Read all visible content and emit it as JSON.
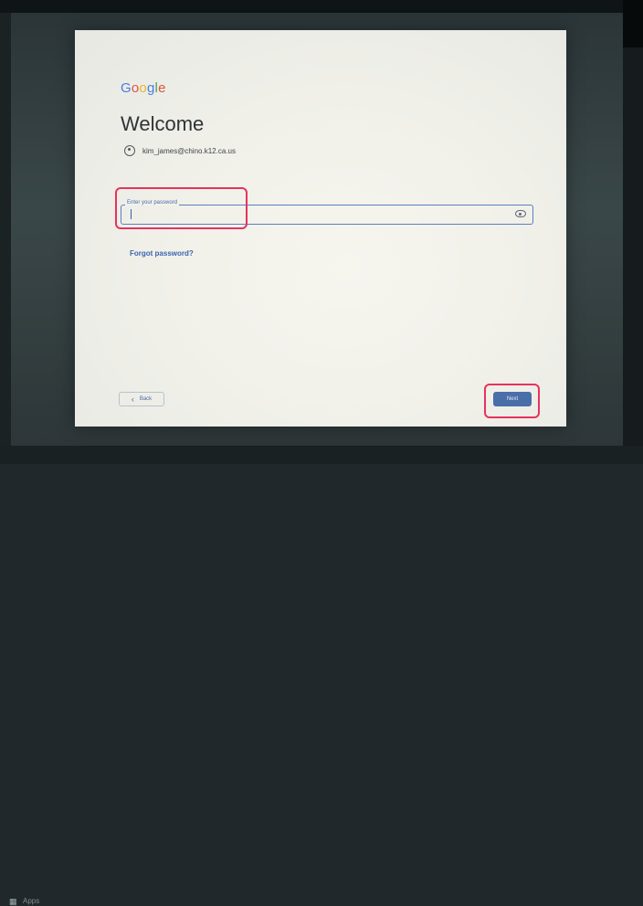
{
  "shelf": {
    "apps_icon": "grid-icon",
    "apps_label": "Apps"
  },
  "dialog": {
    "logo": {
      "letters": [
        {
          "ch": "G",
          "color": "#4a7de0"
        },
        {
          "ch": "o",
          "color": "#e0533f"
        },
        {
          "ch": "o",
          "color": "#e8b532"
        },
        {
          "ch": "g",
          "color": "#4a7de0"
        },
        {
          "ch": "l",
          "color": "#3fa859"
        },
        {
          "ch": "e",
          "color": "#e0533f"
        }
      ]
    },
    "title": "Welcome",
    "account": {
      "icon": "account-circle-icon",
      "email": "kim_james@chino.k12.ca.us"
    },
    "password": {
      "label": "Enter your password",
      "value": "",
      "toggle_icon": "eye-icon"
    },
    "forgot_link": "Forgot password?",
    "back_button": {
      "label": "Back",
      "icon": "chevron-left-icon"
    },
    "next_button": {
      "label": "Next"
    }
  },
  "colors": {
    "accent": "#4a6ea8",
    "highlight": "#e6335d",
    "link": "#3c64b0"
  }
}
